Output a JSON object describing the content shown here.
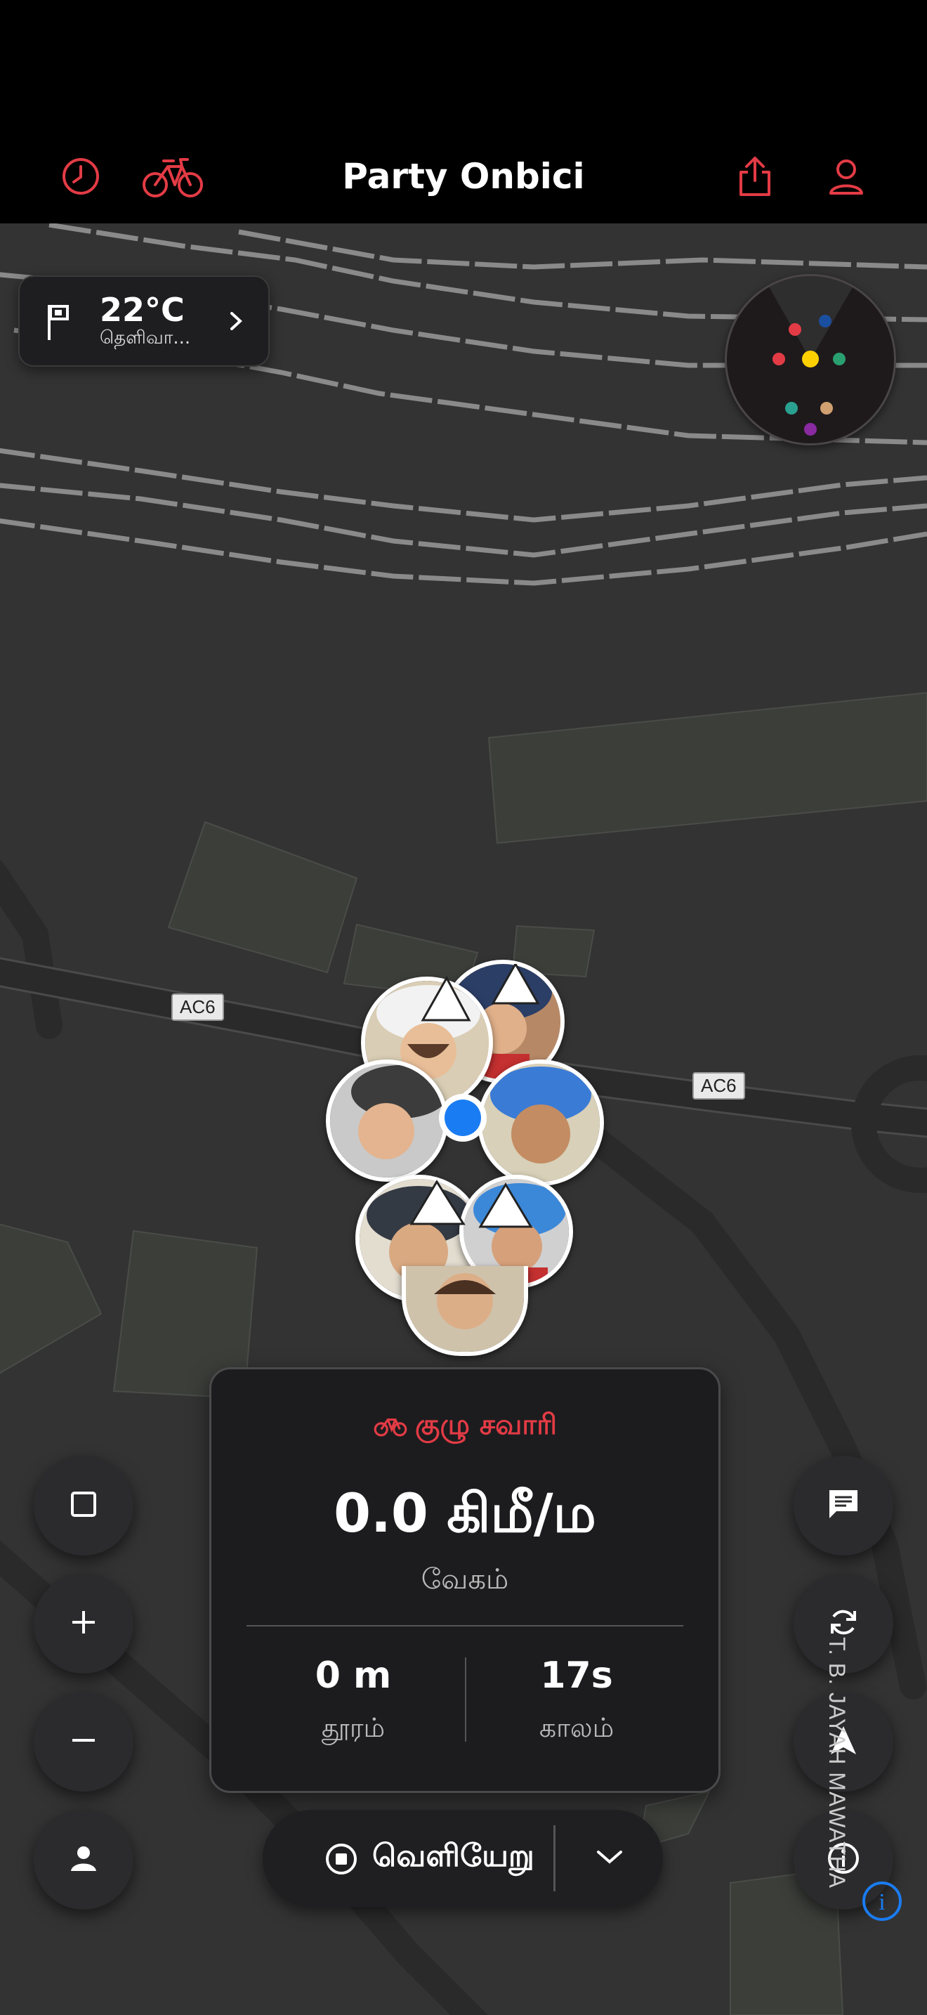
{
  "header": {
    "title": "Party Onbici"
  },
  "icons": {
    "history": "clock-icon",
    "bike": "bicycle-icon",
    "share": "share-icon",
    "profile": "user-icon",
    "flag": "flag-icon",
    "chevron": "chevron-right-icon"
  },
  "weather": {
    "temperature": "22°C",
    "condition": "தெளிவா..."
  },
  "map": {
    "road_labels": [
      "AC6",
      "AC6"
    ],
    "street_name": "T. B. JAYAH MAWATHA"
  },
  "ride_card": {
    "mode_label": "குழு சவாரி",
    "speed_value": "0.0 கிமீ/ம",
    "speed_label": "வேகம்",
    "distance_value": "0 m",
    "distance_label": "தூரம்",
    "time_value": "17s",
    "time_label": "காலம்"
  },
  "exit_bar": {
    "label": "வெளியேறு"
  },
  "colors": {
    "accent": "#e33b45",
    "location_dot": "#1a7cf2",
    "radar_dots": [
      "#e33b45",
      "#1a4fa0",
      "#ffd000",
      "#2aa070",
      "#2aa090",
      "#d0a070",
      "#8a2aa0"
    ]
  }
}
